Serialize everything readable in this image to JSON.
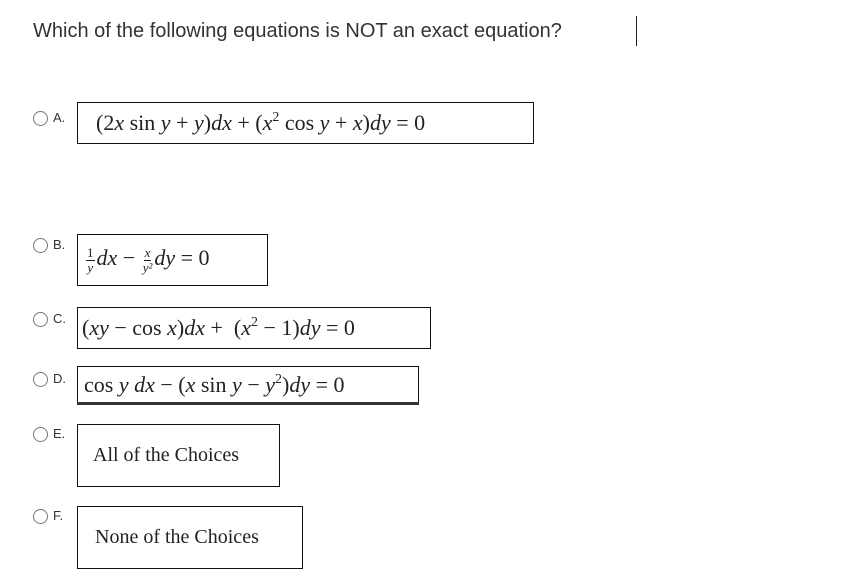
{
  "question": "Which of the following equations is NOT an exact equation?",
  "options": [
    {
      "letter": "A.",
      "equation": "(2x sin y + y)dx + (x² cos y + x)dy = 0"
    },
    {
      "letter": "B.",
      "equation": "(1/y)dx − (x/y²)dy = 0",
      "frac1_num": "1",
      "frac1_den": "y",
      "frac2_num": "x",
      "frac2_den": "y²",
      "rest": "= 0"
    },
    {
      "letter": "C.",
      "equation": "(xy − cos x)dx + (x² − 1)dy = 0"
    },
    {
      "letter": "D.",
      "equation": "cos y dx − (x sin y − y²)dy = 0"
    },
    {
      "letter": "E.",
      "equation": "All of the Choices"
    },
    {
      "letter": "F.",
      "equation": "None of the Choices"
    }
  ],
  "selected": null
}
